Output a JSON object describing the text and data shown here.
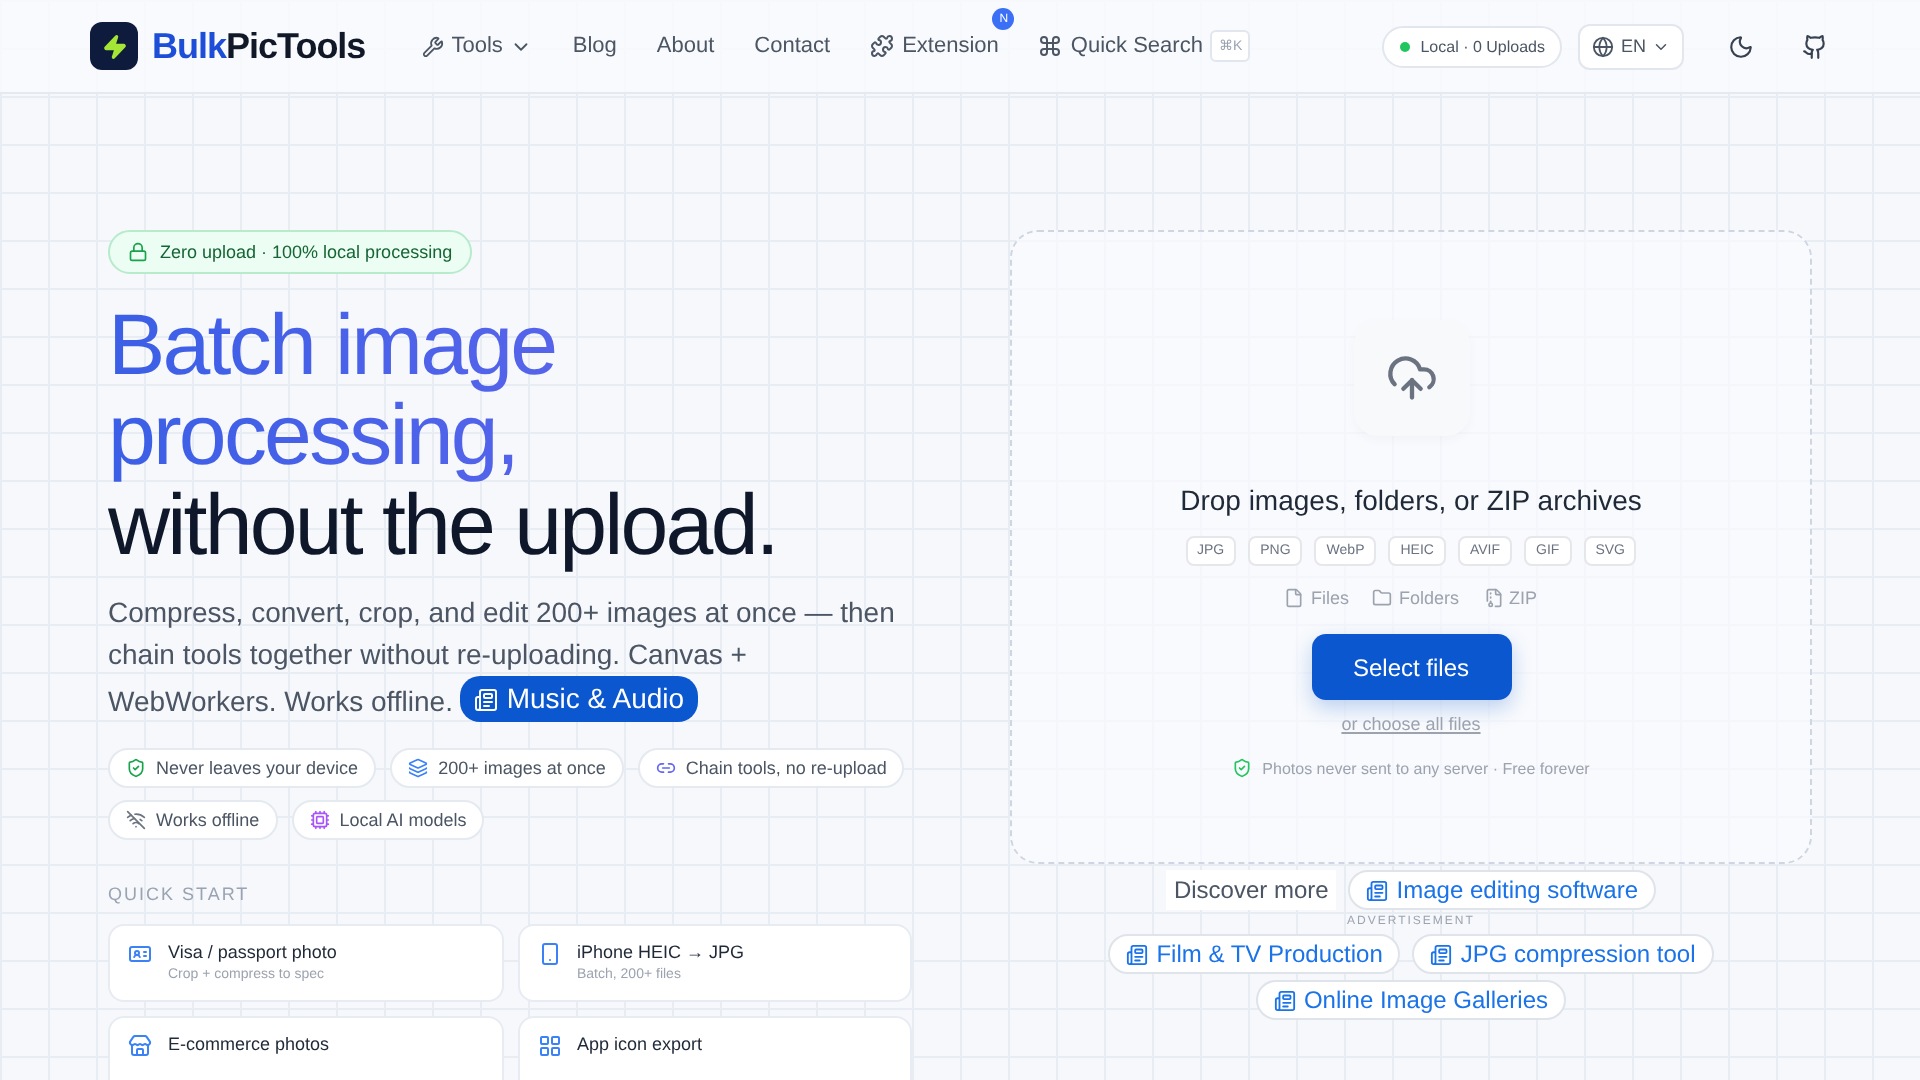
{
  "header": {
    "logo": {
      "brand_primary": "Bulk",
      "brand_secondary": "PicTools"
    },
    "nav": [
      {
        "label": "Tools",
        "kind": "dropdown"
      },
      {
        "label": "Blog",
        "kind": "link"
      },
      {
        "label": "About",
        "kind": "link"
      },
      {
        "label": "Contact",
        "kind": "link"
      },
      {
        "label": "Extension",
        "kind": "badge",
        "badge": "N"
      },
      {
        "label": "Quick Search",
        "kind": "search",
        "shortcut": "⌘K"
      }
    ],
    "status": "Local · 0 Uploads",
    "language": "EN"
  },
  "hero": {
    "badge": "Zero upload · 100% local processing",
    "title_accent": "Batch image processing,",
    "title_rest": "without the upload.",
    "description": "Compress, convert, crop, and edit 200+ images at once — then chain tools together without re-uploading. Canvas + WebWorkers. Works offline.",
    "inline_link": "Music & Audio",
    "features": [
      {
        "label": "Never leaves your device",
        "kind": "shield"
      },
      {
        "label": "200+ images at once",
        "kind": "layers"
      },
      {
        "label": "Chain tools, no re-upload",
        "kind": "link"
      },
      {
        "label": "Works offline",
        "kind": "offline"
      },
      {
        "label": "Local AI models",
        "kind": "chip"
      }
    ],
    "quick_start_title": "QUICK START",
    "quick_start": [
      {
        "title": "Visa / passport photo",
        "subtitle": "Crop + compress to spec",
        "kind": "id"
      },
      {
        "title": "iPhone HEIC → JPG",
        "subtitle": "Batch, 200+ files",
        "kind": "phone"
      },
      {
        "title": "E-commerce photos",
        "kind": "store"
      },
      {
        "title": "App icon export",
        "kind": "grid"
      }
    ]
  },
  "dropzone": {
    "title": "Drop images, folders, or ZIP archives",
    "formats": [
      "JPG",
      "PNG",
      "WebP",
      "HEIC",
      "AVIF",
      "GIF",
      "SVG"
    ],
    "sources": [
      {
        "label": "Files",
        "kind": "file"
      },
      {
        "label": "Folders",
        "kind": "folder"
      },
      {
        "label": "ZIP",
        "kind": "zip"
      }
    ],
    "button": "Select files",
    "alt_link": "or choose all files",
    "note": "Photos never sent to any server · Free forever"
  },
  "discover": {
    "title": "Discover more",
    "ad_label": "ADVERTISEMENT",
    "links": [
      "Image editing software",
      "Film & TV Production",
      "JPG compression tool",
      "Online Image Galleries"
    ]
  }
}
